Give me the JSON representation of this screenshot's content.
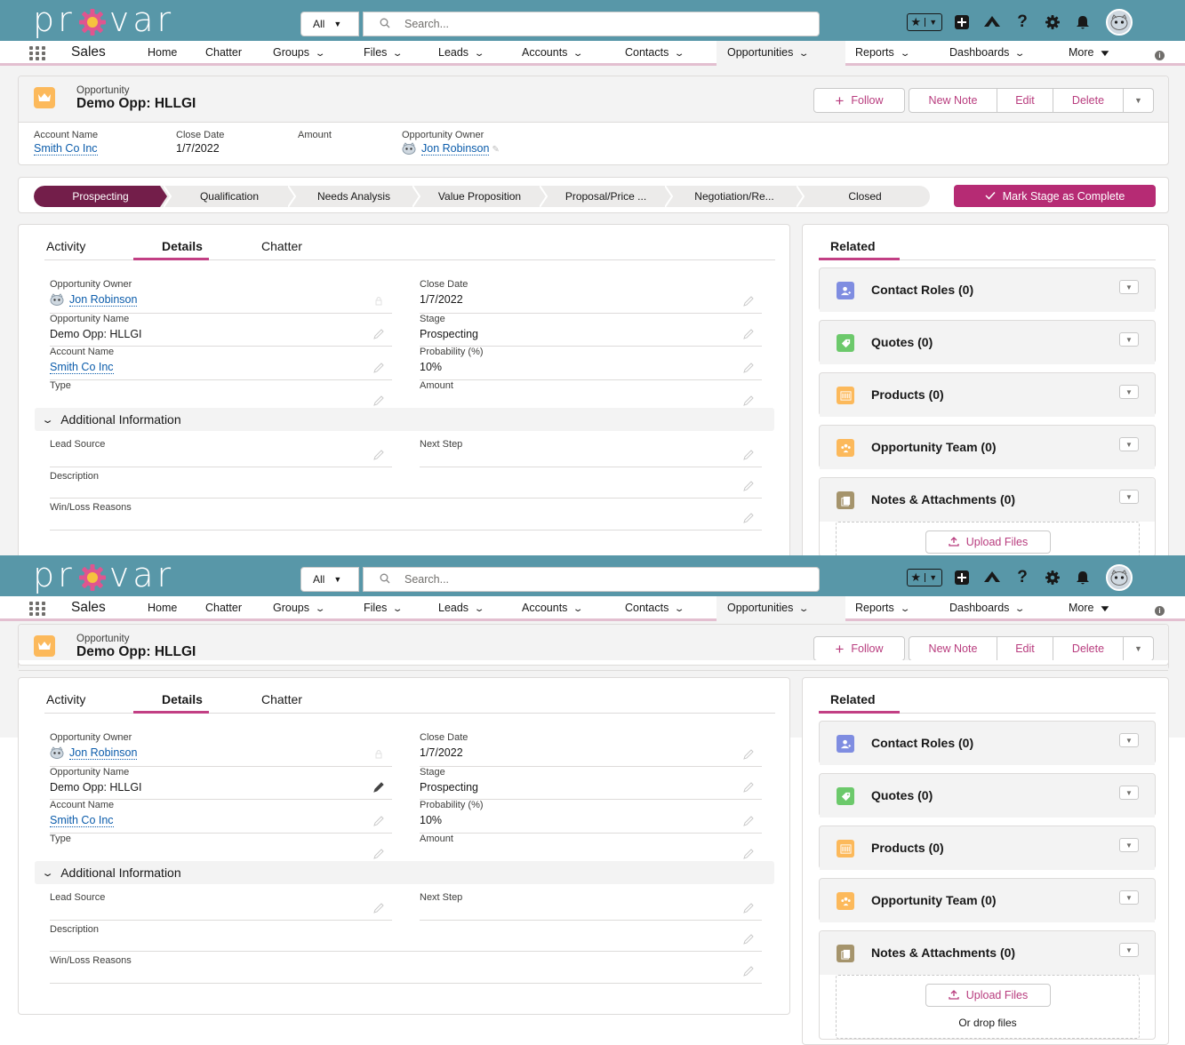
{
  "header": {
    "logo_text_left": "pr",
    "logo_text_right": "var",
    "search_scope": "All",
    "search_placeholder": "Search..."
  },
  "nav": {
    "app_name": "Sales",
    "items": [
      {
        "label": "Home",
        "chevron": false
      },
      {
        "label": "Chatter",
        "chevron": false
      },
      {
        "label": "Groups",
        "chevron": true
      },
      {
        "label": "Files",
        "chevron": true
      },
      {
        "label": "Leads",
        "chevron": true
      },
      {
        "label": "Accounts",
        "chevron": true
      },
      {
        "label": "Contacts",
        "chevron": true
      },
      {
        "label": "Opportunities",
        "chevron": true
      },
      {
        "label": "Reports",
        "chevron": true
      },
      {
        "label": "Dashboards",
        "chevron": true
      },
      {
        "label": "More",
        "chevron": true
      }
    ],
    "active": "Opportunities"
  },
  "record": {
    "object_label": "Opportunity",
    "name": "Demo Opp: HLLGI",
    "actions": {
      "follow": "Follow",
      "new_note": "New Note",
      "edit": "Edit",
      "delete": "Delete"
    }
  },
  "highlights": [
    {
      "label": "Account Name",
      "value": "Smith Co Inc",
      "link": true
    },
    {
      "label": "Close Date",
      "value": "1/7/2022",
      "link": false
    },
    {
      "label": "Amount",
      "value": "",
      "link": false
    },
    {
      "label": "Opportunity Owner",
      "value": "Jon Robinson",
      "link": true
    }
  ],
  "path": {
    "stages": [
      "Prospecting",
      "Qualification",
      "Needs Analysis",
      "Value Proposition",
      "Proposal/Price ...",
      "Negotiation/Re...",
      "Closed"
    ],
    "current": "Prospecting",
    "mark_complete": "Mark Stage as Complete"
  },
  "tabs": [
    "Activity",
    "Details",
    "Chatter"
  ],
  "active_tab": "Details",
  "details": {
    "left": [
      {
        "label": "Opportunity Owner",
        "value": "Jon Robinson"
      },
      {
        "label": "Opportunity Name",
        "value": "Demo Opp: HLLGI"
      },
      {
        "label": "Account Name",
        "value": "Smith Co Inc"
      },
      {
        "label": "Type",
        "value": ""
      }
    ],
    "right": [
      {
        "label": "Close Date",
        "value": "1/7/2022"
      },
      {
        "label": "Stage",
        "value": "Prospecting"
      },
      {
        "label": "Probability (%)",
        "value": "10%"
      },
      {
        "label": "Amount",
        "value": ""
      }
    ],
    "section_title": "Additional Information",
    "additional": [
      {
        "label": "Lead Source",
        "value": ""
      },
      {
        "label": "Next Step",
        "value": ""
      },
      {
        "label": "Description",
        "value": ""
      },
      {
        "label": "Win/Loss Reasons",
        "value": ""
      }
    ]
  },
  "related": {
    "title": "Related",
    "lists": [
      {
        "title": "Contact Roles (0)",
        "icon": "contact-roles-icon",
        "color": "#7f8de1"
      },
      {
        "title": "Quotes (0)",
        "icon": "quotes-icon",
        "color": "#6cc96b"
      },
      {
        "title": "Products (0)",
        "icon": "products-icon",
        "color": "#fcb95b"
      },
      {
        "title": "Opportunity Team (0)",
        "icon": "opportunity-team-icon",
        "color": "#fcb95b"
      },
      {
        "title": "Notes & Attachments (0)",
        "icon": "notes-icon",
        "color": "#a5946c"
      }
    ],
    "upload_label": "Upload Files",
    "drop_label": "Or drop files"
  },
  "colors": {
    "header_bg": "#5897a8",
    "brand_pink": "#b62b74",
    "path_active": "#731e4a",
    "link": "#0b5cab"
  }
}
